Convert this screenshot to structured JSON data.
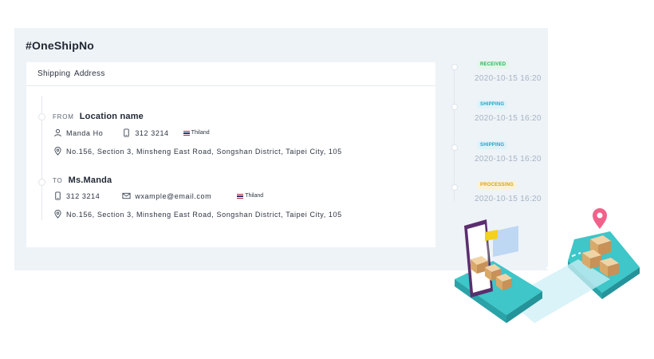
{
  "order": {
    "title": "#OneShipNo"
  },
  "address_card": {
    "header": "Shipping Address",
    "from": {
      "label": "FROM",
      "name": "Location name",
      "contact": "Manda Ho",
      "phone": "312 3214",
      "country": "Thiland",
      "address": "No.156, Section 3, Minsheng East Road, Songshan District, Taipei City, 105"
    },
    "to": {
      "label": "TO",
      "name": "Ms.Manda",
      "phone": "312 3214",
      "email": "wxample@email.com",
      "country": "Thiland",
      "address": "No.156, Section 3, Minsheng East Road, Songshan District, Taipei City, 105"
    }
  },
  "timeline": {
    "events": [
      {
        "status": "RECEIVED",
        "time": "2020-10-15 16:20",
        "color": "#27b35a",
        "bg": "#e3f6ea"
      },
      {
        "status": "SHIPPING",
        "time": "2020-10-15 16:20",
        "color": "#1ea5c8",
        "bg": "#def3f8"
      },
      {
        "status": "SHIPPING",
        "time": "2020-10-15 16:20",
        "color": "#1ea5c8",
        "bg": "#def3f8"
      },
      {
        "status": "PROCESSING",
        "time": "2020-10-15 16:20",
        "color": "#d9a21a",
        "bg": "#fbf2d6"
      }
    ]
  },
  "icons": [
    "person-icon",
    "phone-icon",
    "email-icon",
    "location-pin-icon",
    "flag-icon"
  ]
}
